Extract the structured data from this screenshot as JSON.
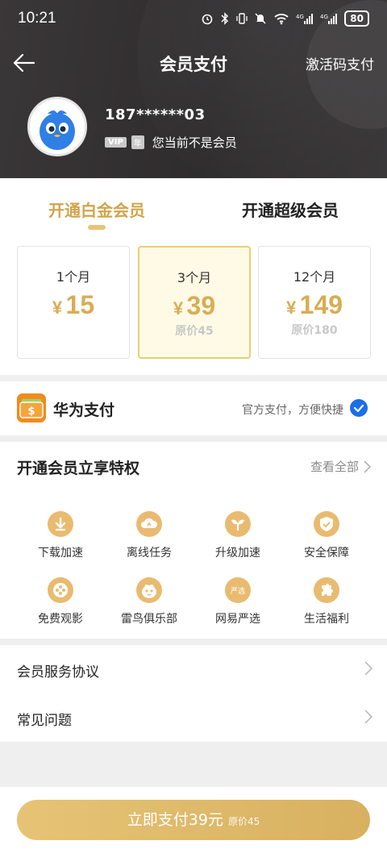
{
  "status_bar": {
    "time": "10:21",
    "icons": [
      "alarm-icon",
      "bluetooth-icon",
      "vibrate-icon",
      "mute-icon",
      "wifi-icon",
      "signal-4g-icon",
      "signal-4g-icon"
    ],
    "battery": "80"
  },
  "nav": {
    "title": "会员支付",
    "right_action": "激活码支付"
  },
  "user": {
    "phone": "187******03",
    "vip_badge": "VIP",
    "year_badge": "年",
    "status": "您当前不是会员"
  },
  "tabs": [
    {
      "label": "开通白金会员",
      "active": true
    },
    {
      "label": "开通超级会员",
      "active": false
    }
  ],
  "plans": [
    {
      "duration": "1个月",
      "currency": "¥",
      "price": "15",
      "original": ""
    },
    {
      "duration": "3个月",
      "currency": "¥",
      "price": "39",
      "original": "原价45",
      "selected": true
    },
    {
      "duration": "12个月",
      "currency": "¥",
      "price": "149",
      "original": "原价180"
    }
  ],
  "payment": {
    "name": "华为支付",
    "desc": "官方支付，方便快捷",
    "selected": true
  },
  "privileges": {
    "title": "开通会员立享特权",
    "view_all": "查看全部",
    "items": [
      {
        "label": "下载加速",
        "icon": "download-accel-icon"
      },
      {
        "label": "离线任务",
        "icon": "cloud-offline-icon"
      },
      {
        "label": "升级加速",
        "icon": "sprout-icon"
      },
      {
        "label": "安全保障",
        "icon": "shield-icon"
      },
      {
        "label": "免费观影",
        "icon": "film-reel-icon"
      },
      {
        "label": "雷鸟俱乐部",
        "icon": "bird-face-icon"
      },
      {
        "label": "网易严选",
        "icon": "yanxuan-icon",
        "icon_text": "严选"
      },
      {
        "label": "生活福利",
        "icon": "puzzle-icon"
      }
    ]
  },
  "links": [
    {
      "label": "会员服务协议"
    },
    {
      "label": "常见问题"
    }
  ],
  "pay_button": {
    "label": "立即支付39元",
    "original": "原价45"
  },
  "colors": {
    "gold": "#d8ad54",
    "header_bg": "#2f2c2e",
    "check_blue": "#1b6ee8",
    "pay_orange": "#f08b1d"
  }
}
